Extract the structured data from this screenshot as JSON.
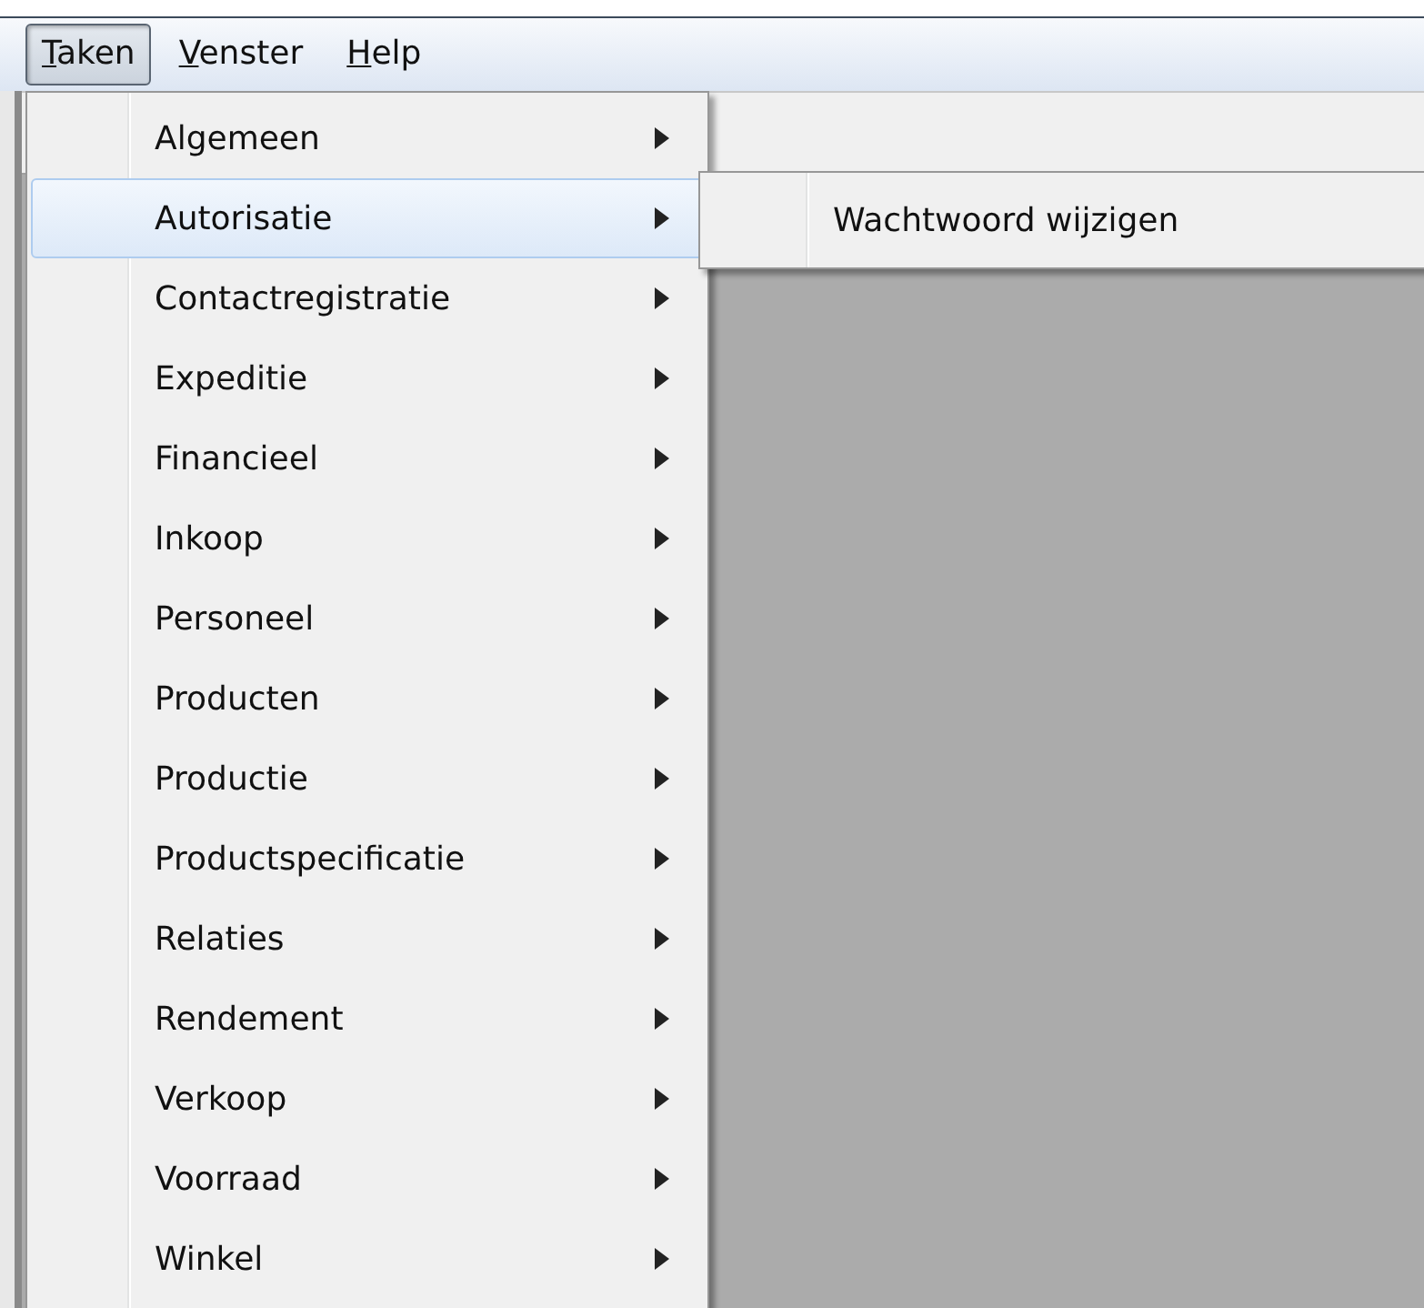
{
  "menu_bar": [
    {
      "label": "Taken",
      "selected": true
    },
    {
      "label": "Venster",
      "selected": false
    },
    {
      "label": "Help",
      "selected": false
    }
  ],
  "menu": {
    "items": [
      {
        "label": "Algemeen",
        "selected": false
      },
      {
        "label": "Autorisatie",
        "selected": true
      },
      {
        "label": "Contactregistratie",
        "selected": false
      },
      {
        "label": "Expeditie",
        "selected": false
      },
      {
        "label": "Financieel",
        "selected": false
      },
      {
        "label": "Inkoop",
        "selected": false
      },
      {
        "label": "Personeel",
        "selected": false
      },
      {
        "label": "Producten",
        "selected": false
      },
      {
        "label": "Productie",
        "selected": false
      },
      {
        "label": "Productspecificatie",
        "selected": false
      },
      {
        "label": "Relaties",
        "selected": false
      },
      {
        "label": "Rendement",
        "selected": false
      },
      {
        "label": "Verkoop",
        "selected": false
      },
      {
        "label": "Voorraad",
        "selected": false
      },
      {
        "label": "Winkel",
        "selected": false
      }
    ]
  },
  "submenu": {
    "items": [
      {
        "label": "Wachtwoord wijzigen",
        "selected": false
      }
    ]
  }
}
